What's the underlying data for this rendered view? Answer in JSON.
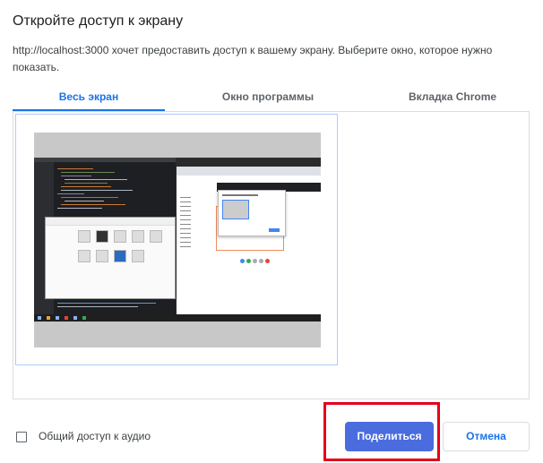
{
  "dialog": {
    "title": "Откройте доступ к экрану",
    "description": "http://localhost:3000 хочет предоставить доступ к вашему экрану. Выберите окно, которое нужно показать."
  },
  "tabs": [
    {
      "label": "Весь экран",
      "active": true
    },
    {
      "label": "Окно программы",
      "active": false
    },
    {
      "label": "Вкладка Chrome",
      "active": false
    }
  ],
  "sources": [
    {
      "kind": "entire-screen-thumbnail",
      "selected": true
    }
  ],
  "audio": {
    "label": "Общий доступ к аудио",
    "checked": false
  },
  "buttons": {
    "share": "Поделиться",
    "cancel": "Отмена"
  },
  "colors": {
    "accent": "#1a73e8",
    "share_button": "#4a6cde",
    "highlight_frame": "#e5001a"
  }
}
